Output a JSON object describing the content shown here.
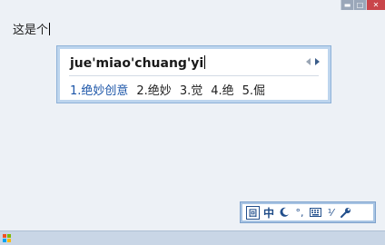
{
  "window_controls": {
    "minimize": "▬",
    "maximize": "□",
    "close": "✕"
  },
  "editor": {
    "text": "这是个"
  },
  "ime": {
    "composition": "jue'miao'chuang'yi",
    "candidates": [
      "1.绝妙创意",
      "2.绝妙",
      "3.觉",
      "4.绝",
      "5.倔"
    ],
    "selected_index": 0
  },
  "status_bar": {
    "logo": "回",
    "language": "中",
    "icons": [
      "logo-icon",
      "chinese-mode-icon",
      "half-width-moon-icon",
      "punctuation-icon",
      "soft-keyboard-icon",
      "simplified-traditional-icon",
      "settings-wrench-icon"
    ],
    "punct": "°,",
    "convert": "⅟"
  },
  "colors": {
    "selected_candidate": "#1b55a8",
    "ime_border": "#bdd5ee",
    "close_button": "#c9454a",
    "start_logo": [
      "#f25022",
      "#7fba00",
      "#00a4ef",
      "#ffb900"
    ]
  }
}
